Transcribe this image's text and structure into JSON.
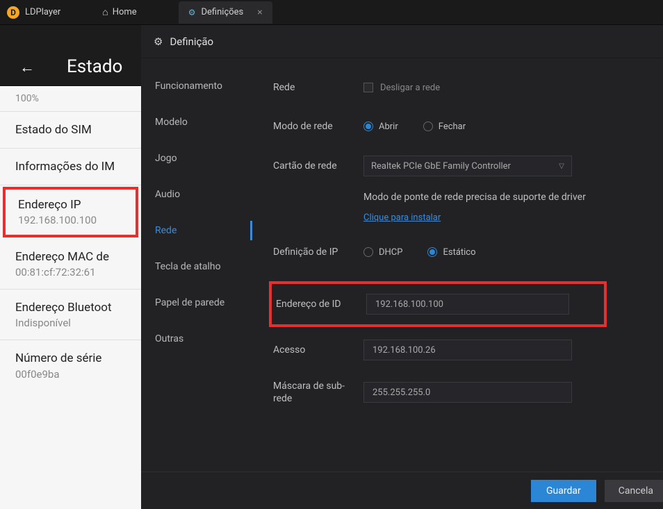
{
  "titlebar": {
    "app_name": "LDPlayer",
    "home_label": "Home",
    "tab_label": "Definições"
  },
  "android": {
    "header_title": "Estado",
    "battery_pct": "100%",
    "items": [
      {
        "title": "Estado do SIM",
        "sub": ""
      },
      {
        "title": "Informações do IM",
        "sub": ""
      },
      {
        "title": "Endereço IP",
        "sub": "192.168.100.100"
      },
      {
        "title": "Endereço MAC de",
        "sub": "00:81:cf:72:32:61"
      },
      {
        "title": "Endereço Bluetoot",
        "sub": "Indisponível"
      },
      {
        "title": "Número de série",
        "sub": "00f0e9ba"
      }
    ]
  },
  "dialog": {
    "title": "Definição",
    "nav": [
      "Funcionamento",
      "Modelo",
      "Jogo",
      "Audio",
      "Rede",
      "Tecla de atalho",
      "Papel de parede",
      "Outras"
    ],
    "network": {
      "rede_label": "Rede",
      "desligar_label": "Desligar a rede",
      "modo_label": "Modo de rede",
      "abrir_label": "Abrir",
      "fechar_label": "Fechar",
      "cartao_label": "Cartão de rede",
      "cartao_value": "Realtek PCIe GbE Family Controller",
      "note": "Modo de ponte de rede precisa de suporte de driver",
      "install_link": "Clique para instalar",
      "ipdef_label": "Definição de IP",
      "dhcp_label": "DHCP",
      "estatico_label": "Estático",
      "endereco_label": "Endereço de ID",
      "endereco_value": "192.168.100.100",
      "acesso_label": "Acesso",
      "acesso_value": "192.168.100.26",
      "mascara_label": "Máscara de sub-rede",
      "mascara_value": "255.255.255.0"
    },
    "footer": {
      "save": "Guardar",
      "cancel": "Cancela"
    }
  }
}
